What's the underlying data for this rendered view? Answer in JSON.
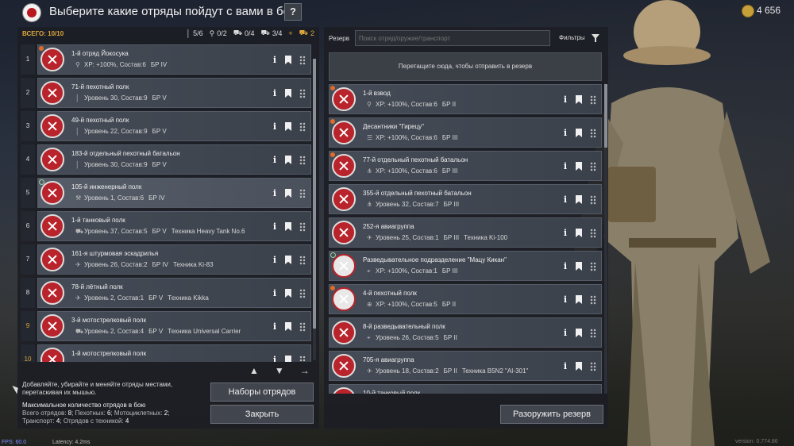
{
  "header": {
    "title": "Выберите какие отряды пойдут с вами в бой",
    "help_label": "?",
    "coins": "4 656"
  },
  "left": {
    "total": "ВСЕГО: 10/10",
    "stats": [
      {
        "icon": "infantry-icon",
        "value": "5/6"
      },
      {
        "icon": "paratrooper-icon",
        "value": "0/2"
      },
      {
        "icon": "vehicle-icon",
        "value": "0/4"
      },
      {
        "icon": "tank-icon",
        "value": "3/4"
      },
      {
        "icon": "plus-icon",
        "value": "+"
      },
      {
        "icon": "gold-vehicle-icon",
        "value": "2"
      }
    ],
    "squads": [
      {
        "num": "1",
        "name": "1-й отряд Йокосука",
        "icon": "parachute-icon",
        "info": "XP: +100%, Состав:6",
        "br": "БР IV",
        "tech": "",
        "badge": "orange"
      },
      {
        "num": "2",
        "name": "71-й пехотный полк",
        "icon": "infantry-icon",
        "info": "Уровень 30, Состав:9",
        "br": "БР V",
        "tech": "",
        "badge": ""
      },
      {
        "num": "3",
        "name": "49-й пехотный полк",
        "icon": "infantry-icon",
        "info": "Уровень 22, Состав:9",
        "br": "БР V",
        "tech": "",
        "badge": ""
      },
      {
        "num": "4",
        "name": "183-й отдельный пехотный батальон",
        "icon": "infantry-icon",
        "info": "Уровень 30, Состав:9",
        "br": "БР V",
        "tech": "",
        "badge": ""
      },
      {
        "num": "5",
        "name": "105-й инженерный полк",
        "icon": "wrench-icon",
        "info": "Уровень 1, Состав:6",
        "br": "БР IV",
        "tech": "",
        "badge": "green",
        "highlight": true
      },
      {
        "num": "6",
        "name": "1-й танковый полк",
        "icon": "tank-icon",
        "info": "Уровень 37, Состав:5",
        "br": "БР V",
        "tech": "Техника Heavy Tank No.6",
        "badge": ""
      },
      {
        "num": "7",
        "name": "161-я штурмовая эскадрилья",
        "icon": "plane-icon",
        "info": "Уровень 26, Состав:2",
        "br": "БР IV",
        "tech": "Техника Ki-83",
        "badge": ""
      },
      {
        "num": "8",
        "name": "78-й лётный полк",
        "icon": "plane-icon",
        "info": "Уровень 2, Состав:1",
        "br": "БР V",
        "tech": "Техника Kikka",
        "badge": ""
      },
      {
        "num": "9",
        "name": "3-й мотострелковый полк",
        "icon": "vehicle-icon",
        "info": "Уровень 2, Состав:4",
        "br": "БР V",
        "tech": "Техника Universal Carrier",
        "badge": "",
        "gold": true
      },
      {
        "num": "10",
        "name": "1-й мотострелковый полк",
        "icon": "vehicle-icon",
        "info": "",
        "br": "",
        "tech": "",
        "badge": "",
        "gold": true
      }
    ],
    "arrows": [
      "▲",
      "▼",
      "→"
    ],
    "hint": "Добавляйте, убирайте и меняйте отряды местами, перетаскивая их мышью.",
    "max_title": "Максимальное количество отрядов в бою",
    "max_line1_label": "Всего отрядов: ",
    "max_line1_value": "8",
    "max_line1b_label": "; Пехотных: ",
    "max_line1b_value": "6",
    "max_line1c_label": "; Мотоциклетных: ",
    "max_line1c_value": "2",
    "max_line1d": ";",
    "max_line2_label": "Транспорт: ",
    "max_line2_value": "4",
    "max_line2b_label": "; Отрядов с техникой: ",
    "max_line2b_value": "4",
    "presets_button": "Наборы отрядов",
    "close_button": "Закрыть"
  },
  "right": {
    "reserve_label": "Резерв",
    "search_placeholder": "Поиск отряд/оружие/транспорт",
    "filters_label": "Фильтры",
    "drop_zone": "Перетащите сюда, чтобы отправить в резерв",
    "squads": [
      {
        "name": "1-й взвод",
        "icon": "parachute-icon",
        "info": "XP: +100%, Состав:6",
        "br": "БР II",
        "tech": "",
        "badge": "orange"
      },
      {
        "name": "Десантники \"Гирецу\"",
        "icon": "list-icon",
        "info": "XP: +100%, Состав:6",
        "br": "БР III",
        "tech": "",
        "badge": "orange"
      },
      {
        "name": "77-й отдельный пехотный батальон",
        "icon": "group-icon",
        "info": "XP: +100%, Состав:6",
        "br": "БР III",
        "tech": "",
        "badge": "orange"
      },
      {
        "name": "355-й отдельный пехотный батальон",
        "icon": "group-icon",
        "info": "Уровень 32, Состав:7",
        "br": "БР III",
        "tech": "",
        "badge": ""
      },
      {
        "name": "252-я авиагруппа",
        "icon": "plane-icon",
        "info": "Уровень 25, Состав:1",
        "br": "БР III",
        "tech": "Техника Ki-100",
        "badge": ""
      },
      {
        "name": "Разведывательное подразделение \"Мацу Кикан\"",
        "icon": "scout-icon",
        "info": "XP: +100%, Состав:1",
        "br": "БР III",
        "tech": "",
        "badge": "green",
        "white": true
      },
      {
        "name": "4-й пехотный полк",
        "icon": "target-icon",
        "info": "XP: +100%, Состав:5",
        "br": "БР II",
        "tech": "",
        "badge": "orange",
        "white": true
      },
      {
        "name": "8-й разведывательный полк",
        "icon": "scout-icon",
        "info": "Уровень 26, Состав:5",
        "br": "БР II",
        "tech": "",
        "badge": ""
      },
      {
        "name": "705-я авиагруппа",
        "icon": "plane-icon",
        "info": "Уровень 18, Состав:2",
        "br": "БР II",
        "tech": "Техника B5N2 \"AI-301\"",
        "badge": ""
      },
      {
        "name": "10-й танковый полк",
        "icon": "tank-icon",
        "info": "",
        "br": "",
        "tech": "",
        "badge": ""
      }
    ],
    "disarm_button": "Разоружить резерв"
  },
  "footer": {
    "fps": "FPS: 60.0",
    "latency": "Latency: 4.2ms",
    "version": "version: 0.774.86"
  },
  "colors": {
    "accent": "#e0a83a",
    "emblem_red": "#b9232b",
    "panel": "#1c1e24"
  }
}
